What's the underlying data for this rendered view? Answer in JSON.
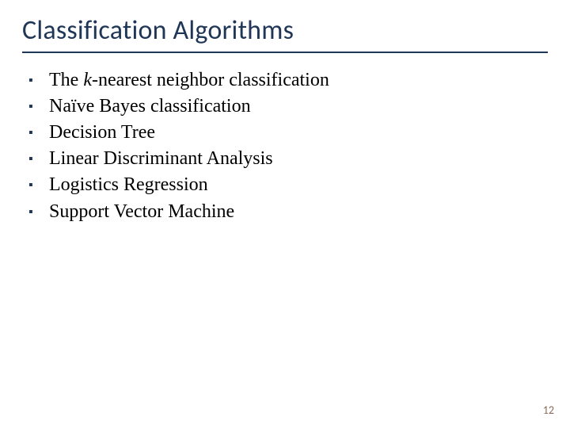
{
  "title": "Classification Algorithms",
  "bullets": [
    {
      "prefix": "The ",
      "emph": "k",
      "suffix": "-nearest neighbor classification"
    },
    {
      "prefix": "Naïve Bayes classification",
      "emph": "",
      "suffix": ""
    },
    {
      "prefix": "Decision Tree",
      "emph": "",
      "suffix": ""
    },
    {
      "prefix": "Linear Discriminant Analysis",
      "emph": "",
      "suffix": ""
    },
    {
      "prefix": "Logistics Regression",
      "emph": "",
      "suffix": ""
    },
    {
      "prefix": "Support Vector Machine",
      "emph": "",
      "suffix": ""
    }
  ],
  "page_number": "12",
  "bullet_glyph": "▪"
}
